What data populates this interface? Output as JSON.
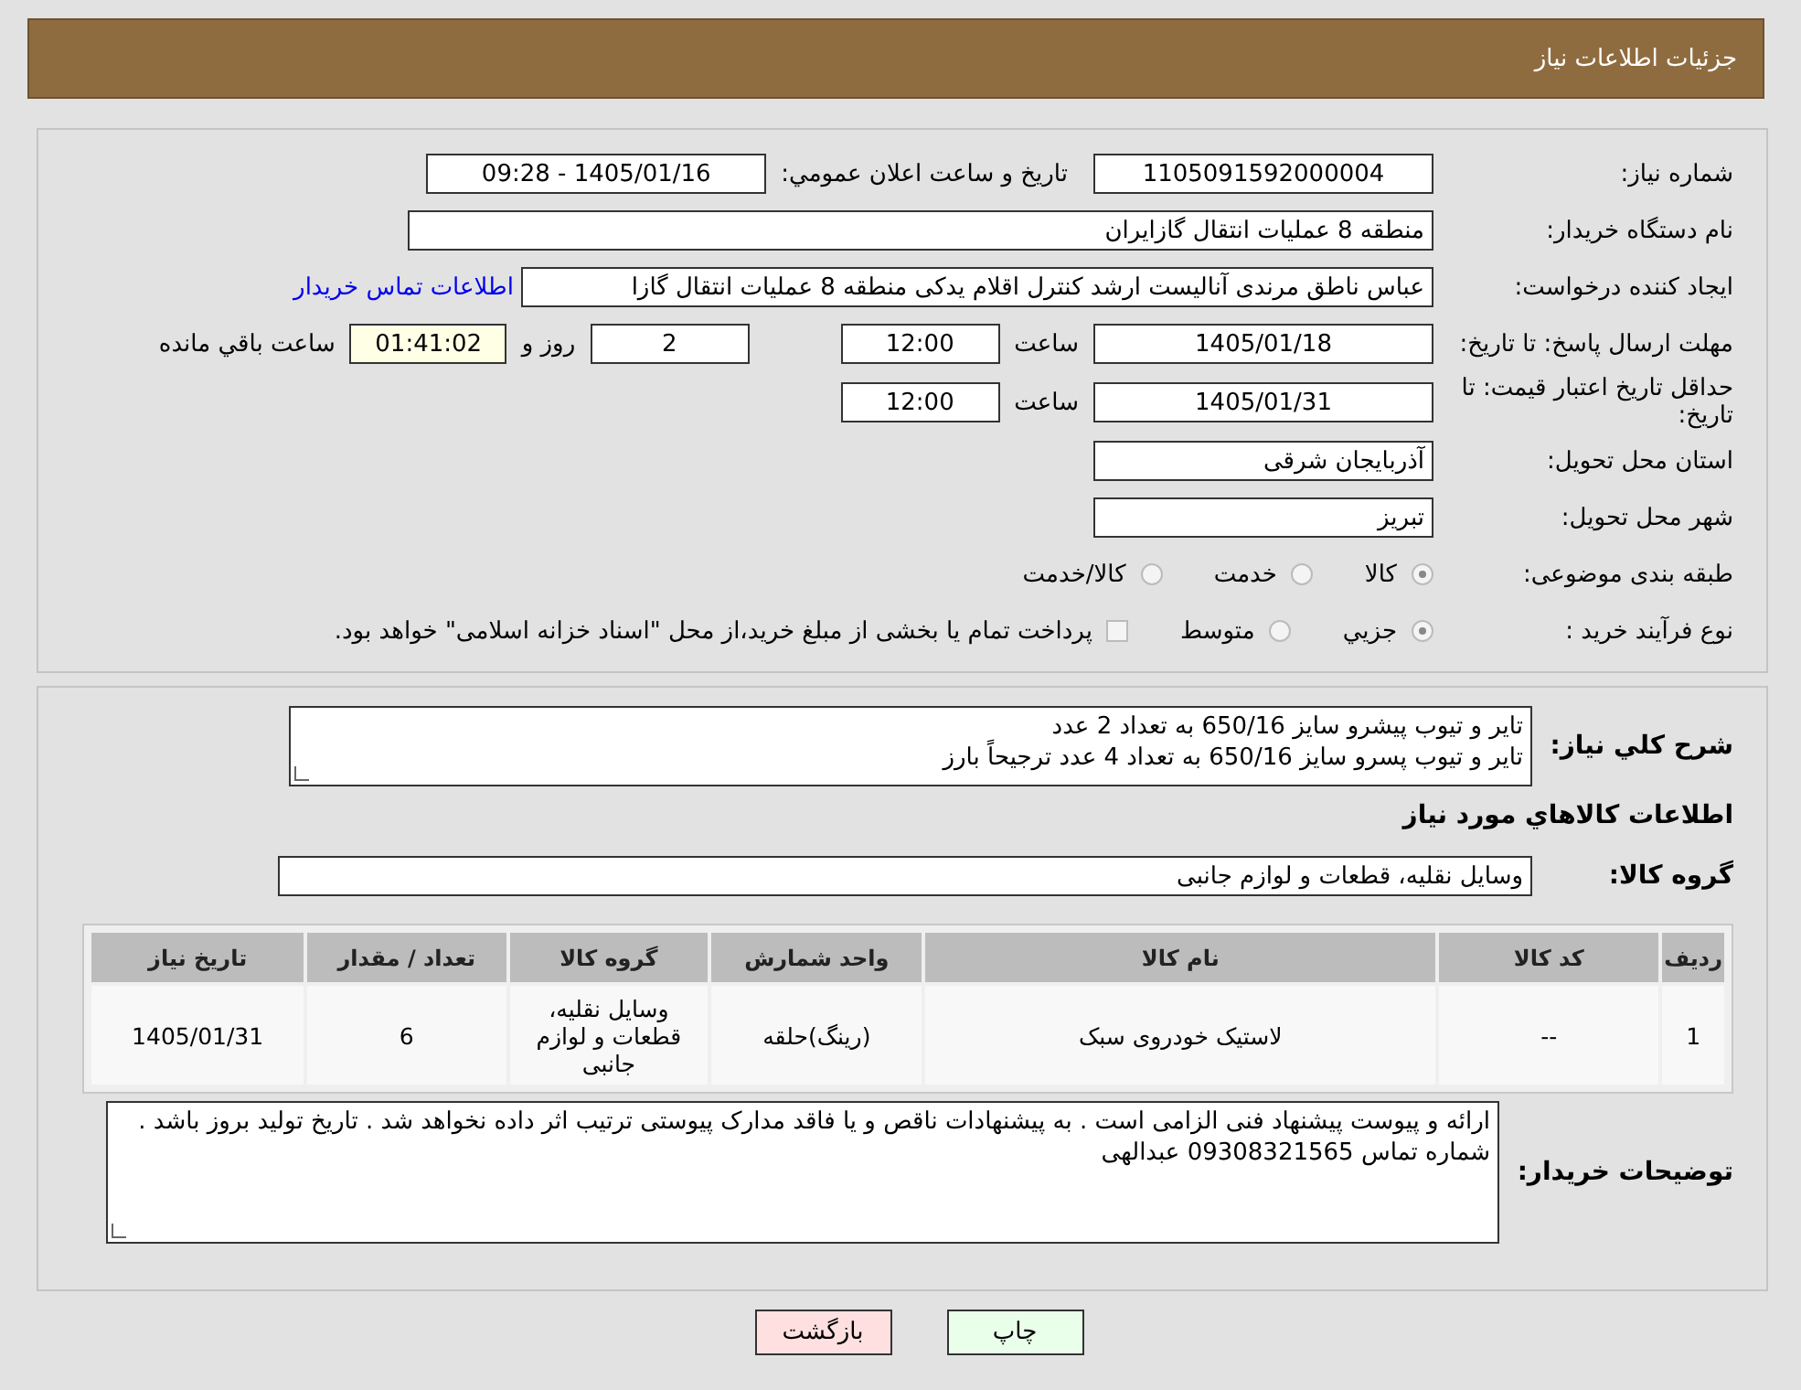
{
  "header": {
    "title": "جزئیات اطلاعات نیاز"
  },
  "need_number": {
    "label": "شماره نیاز:",
    "value": "1105091592000004"
  },
  "announce": {
    "label": "تاریخ و ساعت اعلان عمومي:",
    "value": "1405/01/16 - 09:28"
  },
  "buyer_org": {
    "label": "نام دستگاه خریدار:",
    "value": "منطقه 8 عملیات انتقال گازایران"
  },
  "creator": {
    "label": "ایجاد کننده درخواست:",
    "value": "عباس ناطق مرندی آنالیست ارشد کنترل اقلام یدکی منطقه 8 عملیات انتقال گازا",
    "link": "اطلاعات تماس خریدار"
  },
  "deadline": {
    "label": "مهلت ارسال پاسخ: تا تاریخ:",
    "date": "1405/01/18",
    "time_label": "ساعت",
    "time": "12:00",
    "days": "2",
    "days_label": "روز و",
    "remaining": "01:41:02",
    "remaining_label": "ساعت باقي مانده"
  },
  "validity": {
    "label": "حداقل تاریخ اعتبار قیمت: تا تاریخ:",
    "date": "1405/01/31",
    "time_label": "ساعت",
    "time": "12:00"
  },
  "province": {
    "label": "استان محل تحویل:",
    "value": "آذربایجان شرقی"
  },
  "city": {
    "label": "شهر محل تحویل:",
    "value": "تبریز"
  },
  "category": {
    "label": "طبقه بندی موضوعی:",
    "options": [
      {
        "label": "کالا",
        "selected": true
      },
      {
        "label": "خدمت",
        "selected": false
      },
      {
        "label": "کالا/خدمت",
        "selected": false
      }
    ]
  },
  "process": {
    "label": "نوع فرآیند خرید :",
    "options": [
      {
        "label": "جزيي",
        "selected": true
      },
      {
        "label": "متوسط",
        "selected": false
      }
    ],
    "payment": {
      "label": "پرداخت تمام یا بخشی از مبلغ خرید،از محل \"اسناد خزانه اسلامی\" خواهد بود.",
      "checked": false
    }
  },
  "description": {
    "label": "شرح كلي نياز:",
    "lines": [
      "تایر و تیوب پیشرو سایز 650/16 به تعداد 2 عدد",
      "تایر و تیوب پسرو سایز 650/16 به تعداد 4 عدد ترجیحاً بارز"
    ]
  },
  "goods_title": "اطلاعات كالاهاي مورد نياز",
  "goods_group": {
    "label": "گروه کالا:",
    "value": "وسایل نقلیه، قطعات و لوازم جانبی"
  },
  "table": {
    "columns": [
      "ردیف",
      "کد کالا",
      "نام کالا",
      "واحد شمارش",
      "گروه کالا",
      "تعداد / مقدار",
      "تاریخ نیاز"
    ],
    "rows": [
      [
        "1",
        "--",
        "لاستیک خودروی سبک",
        "(رینگ)حلقه",
        "وسایل نقلیه، قطعات و لوازم جانبی",
        "6",
        "1405/01/31"
      ]
    ]
  },
  "buyer_notes": {
    "label": "توضیحات خریدار:",
    "text": "ارائه و پیوست پیشنهاد فنی الزامی است . به پیشنهادات ناقص و یا فاقد مدارک پیوستی ترتیب اثر داده نخواهد شد . تاریخ تولید بروز باشد . شماره تماس 09308321565 عبدالهی"
  },
  "buttons": [
    {
      "label": "چاپ",
      "kind": "print"
    },
    {
      "label": "بازگشت",
      "kind": "back"
    }
  ]
}
